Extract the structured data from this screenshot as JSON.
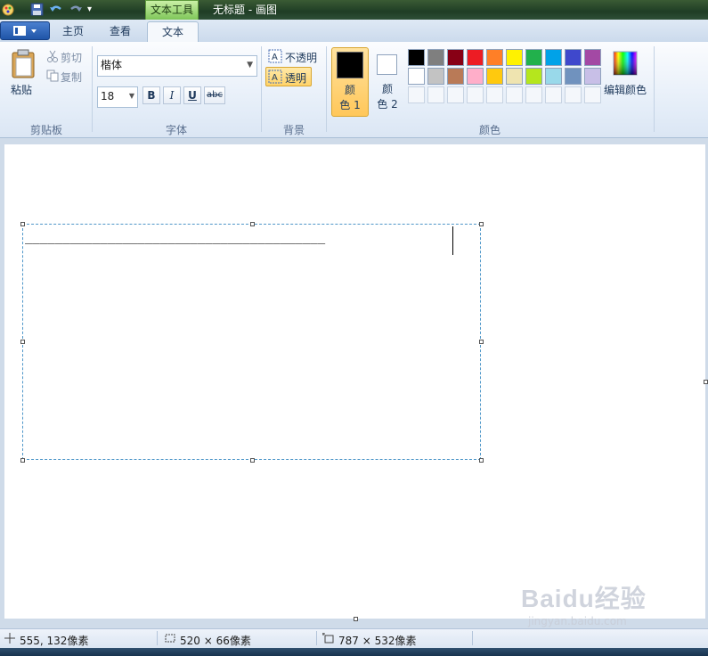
{
  "titlebar": {
    "contextual_tab": "文本工具",
    "title": "无标题 - 画图"
  },
  "tabs": [
    {
      "label": "主页"
    },
    {
      "label": "查看"
    },
    {
      "label": "文本"
    }
  ],
  "clipboard": {
    "paste": "粘贴",
    "cut": "剪切",
    "copy": "复制",
    "group": "剪贴板"
  },
  "font": {
    "family": "楷体",
    "size": "18",
    "bold": "B",
    "italic": "I",
    "underline": "U",
    "strikethrough": "abc",
    "group": "字体"
  },
  "background": {
    "opaque": "不透明",
    "transparent": "透明",
    "group": "背景"
  },
  "colors": {
    "color1_line1": "颜",
    "color1_line2": "色 1",
    "color2_line1": "颜",
    "color2_line2": "色 2",
    "edit": "编辑颜色",
    "group": "颜色",
    "color1_value": "#000000",
    "color2_value": "#ffffff",
    "palette_row1": [
      "#000000",
      "#7f7f7f",
      "#880015",
      "#ed1c24",
      "#ff7f27",
      "#fff200",
      "#22b14c",
      "#00a2e8",
      "#3f48cc",
      "#a349a4"
    ],
    "palette_row2": [
      "#ffffff",
      "#c3c3c3",
      "#b97a57",
      "#ffaec9",
      "#ffc90e",
      "#efe4b0",
      "#b5e61d",
      "#99d9ea",
      "#7092be",
      "#c8bfe7"
    ]
  },
  "canvas": {
    "typed_text": "________________________________________"
  },
  "status": {
    "cursor_pos": "555, 132像素",
    "selection_size": "520 × 66像素",
    "canvas_size": "787 × 532像素"
  },
  "watermark": {
    "brand": "Baidu经验",
    "url": "jingyan.baidu.com"
  }
}
